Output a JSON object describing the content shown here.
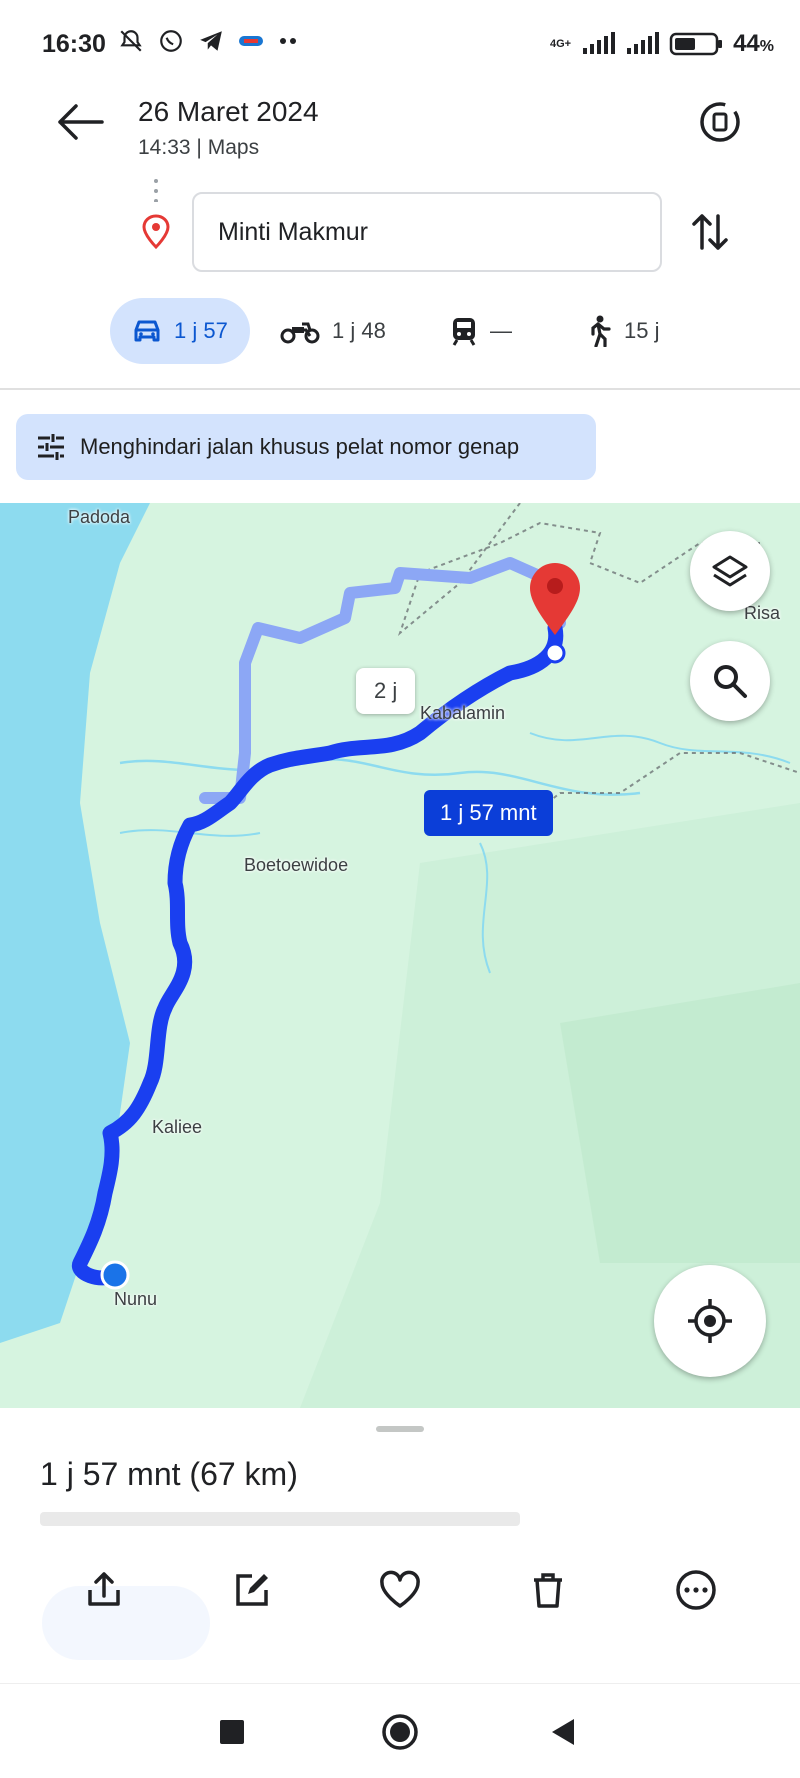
{
  "status_bar": {
    "time": "16:30",
    "network": "4G+",
    "battery": "44",
    "battery_unit": "%",
    "icons": [
      "mute-icon",
      "whatsapp-icon",
      "telegram-icon",
      "app-icon",
      "more-dots-icon",
      "wifi-icon",
      "signal-icon",
      "battery-icon"
    ]
  },
  "header": {
    "date": "26 Maret 2024",
    "time": "14:33",
    "source": "Maps",
    "separator": "|",
    "destination": "Minti Makmur"
  },
  "modes": [
    {
      "name": "car",
      "time": "1 j 57",
      "active": true
    },
    {
      "name": "motorcycle",
      "time": "1 j 48",
      "active": false
    },
    {
      "name": "transit",
      "time": "—",
      "active": false
    },
    {
      "name": "walk",
      "time": "15 j",
      "active": false
    }
  ],
  "chip": {
    "label": "Menghindari jalan khusus pelat nomor genap"
  },
  "map": {
    "places": [
      "Padoda",
      "Risa",
      "Kabalamin",
      "Boetoewidoe",
      "Kaliee",
      "Nunu"
    ],
    "route_main_label": "1 j 57 mnt",
    "route_alt_label": "2 j",
    "colors": {
      "route_main": "#1a3ff0",
      "route_alt": "#8ca7f5",
      "sea": "#8ddbef",
      "land": "#d6f4e0",
      "pin": "#e53935"
    }
  },
  "sheet": {
    "summary": "1 j 57 mnt (67 km)",
    "actions": [
      "share-icon",
      "edit-icon",
      "favorite-icon",
      "delete-icon",
      "more-icon"
    ]
  },
  "navbar": {
    "buttons": [
      "recents-button",
      "home-button",
      "back-button"
    ]
  }
}
